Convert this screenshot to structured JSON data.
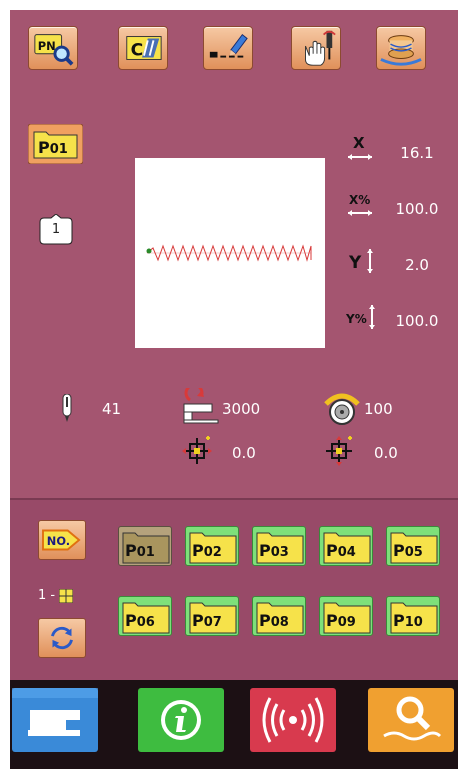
{
  "toolbar": {
    "buttons": [
      {
        "id": "pattern-search",
        "label": "PN",
        "icon": "magnifier-icon"
      },
      {
        "id": "copy",
        "label": "C",
        "icon": "copy-icon"
      },
      {
        "id": "draw",
        "label": "",
        "icon": "pencil-icon"
      },
      {
        "id": "manual",
        "label": "",
        "icon": "hand-needle-icon"
      },
      {
        "id": "winder",
        "label": "",
        "icon": "bobbin-icon"
      }
    ]
  },
  "pattern": {
    "current": {
      "prefix": "P",
      "number": "01"
    },
    "bubble_value": "1"
  },
  "params": [
    {
      "label": "X",
      "value": "16.1"
    },
    {
      "label": "X%",
      "value": "100.0"
    },
    {
      "label": "Y",
      "value": "2.0"
    },
    {
      "label": "Y%",
      "value": "100.0"
    }
  ],
  "stats": {
    "needle": "41",
    "speed": "3000",
    "tension": "100",
    "move_x": "0.0",
    "move_y": "0.0"
  },
  "list": {
    "no_label": "NO.",
    "page_label": "1 -",
    "patterns": [
      {
        "prefix": "P",
        "number": "01",
        "selected": true
      },
      {
        "prefix": "P",
        "number": "02",
        "selected": false
      },
      {
        "prefix": "P",
        "number": "03",
        "selected": false
      },
      {
        "prefix": "P",
        "number": "04",
        "selected": false
      },
      {
        "prefix": "P",
        "number": "05",
        "selected": false
      },
      {
        "prefix": "P",
        "number": "06",
        "selected": false
      },
      {
        "prefix": "P",
        "number": "07",
        "selected": false
      },
      {
        "prefix": "P",
        "number": "08",
        "selected": false
      },
      {
        "prefix": "P",
        "number": "09",
        "selected": false
      },
      {
        "prefix": "P",
        "number": "10",
        "selected": false
      }
    ]
  },
  "nav": [
    {
      "id": "sew",
      "icon": "sewing-machine-icon",
      "color": "#3a8ad8"
    },
    {
      "id": "info",
      "icon": "info-icon",
      "color": "#3ebc40"
    },
    {
      "id": "communication",
      "icon": "signal-icon",
      "color": "#d83a4e"
    },
    {
      "id": "search",
      "icon": "search-icon",
      "color": "#f0a030"
    }
  ]
}
